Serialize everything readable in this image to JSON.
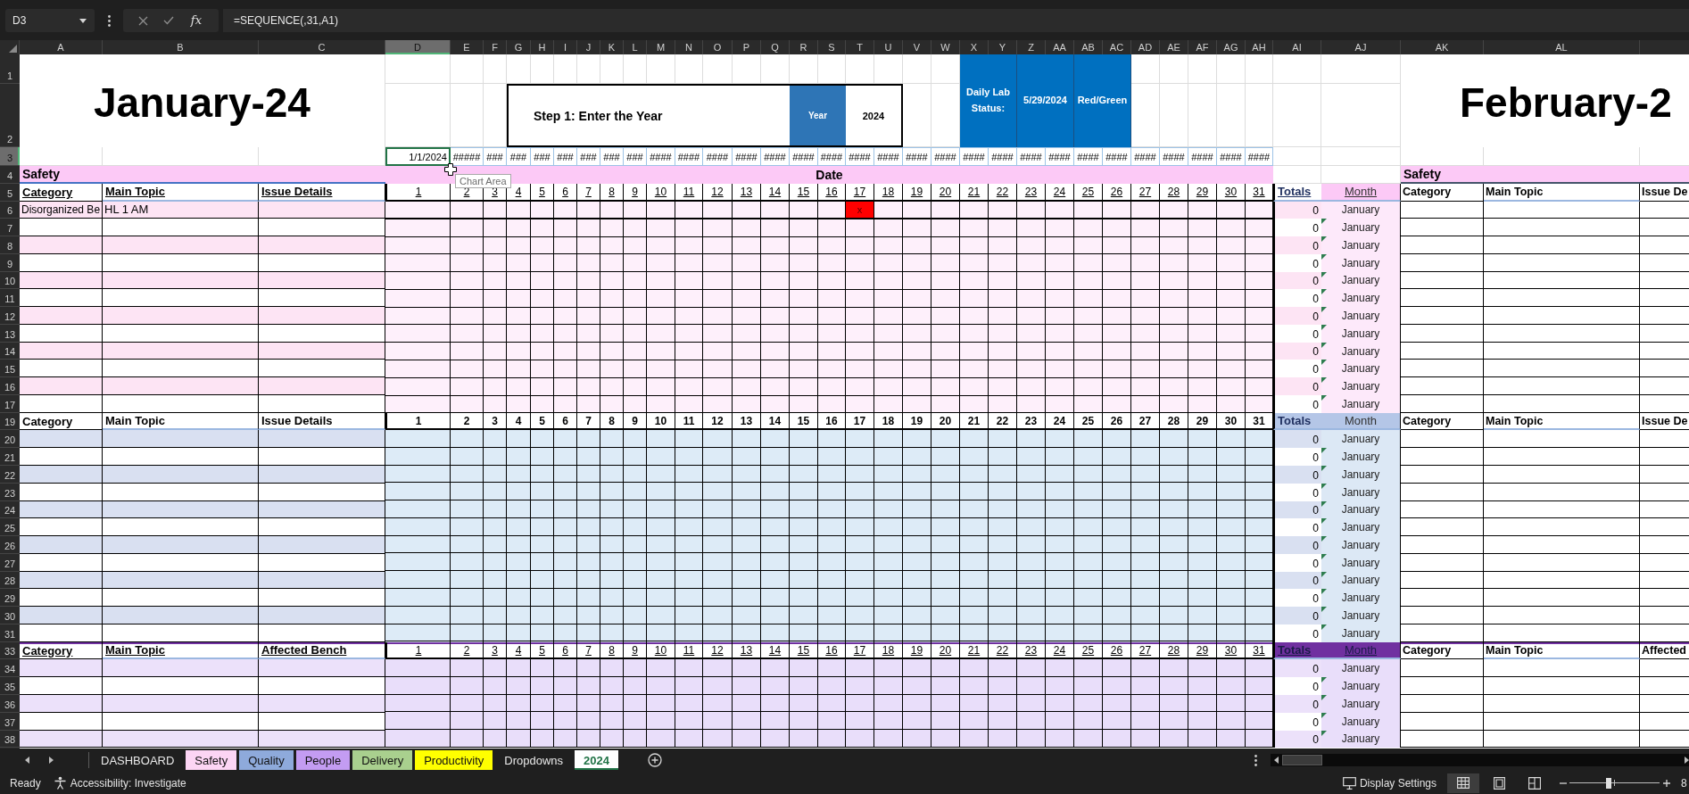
{
  "formula_bar": {
    "name_box": "D3",
    "function_label": "fx",
    "formula": "=SEQUENCE(,31,A1)"
  },
  "column_headers": [
    {
      "label": "A",
      "selected": false
    },
    {
      "label": "B",
      "selected": false
    },
    {
      "label": "C",
      "selected": false
    },
    {
      "label": "D",
      "selected": true
    },
    {
      "label": "E",
      "selected": false
    },
    {
      "label": "F",
      "selected": false
    },
    {
      "label": "G",
      "selected": false
    },
    {
      "label": "H",
      "selected": false
    },
    {
      "label": "I",
      "selected": false
    },
    {
      "label": "J",
      "selected": false
    },
    {
      "label": "K",
      "selected": false
    },
    {
      "label": "L",
      "selected": false
    },
    {
      "label": "M",
      "selected": false
    },
    {
      "label": "N",
      "selected": false
    },
    {
      "label": "O",
      "selected": false
    },
    {
      "label": "P",
      "selected": false
    },
    {
      "label": "Q",
      "selected": false
    },
    {
      "label": "R",
      "selected": false
    },
    {
      "label": "S",
      "selected": false
    },
    {
      "label": "T",
      "selected": false
    },
    {
      "label": "U",
      "selected": false
    },
    {
      "label": "V",
      "selected": false
    },
    {
      "label": "W",
      "selected": false
    },
    {
      "label": "X",
      "selected": false
    },
    {
      "label": "Y",
      "selected": false
    },
    {
      "label": "Z",
      "selected": false
    },
    {
      "label": "AA",
      "selected": false
    },
    {
      "label": "AB",
      "selected": false
    },
    {
      "label": "AC",
      "selected": false
    },
    {
      "label": "AD",
      "selected": false
    },
    {
      "label": "AE",
      "selected": false
    },
    {
      "label": "AF",
      "selected": false
    },
    {
      "label": "AG",
      "selected": false
    },
    {
      "label": "AH",
      "selected": false
    },
    {
      "label": "AI",
      "selected": false
    },
    {
      "label": "AJ",
      "selected": false
    },
    {
      "label": "AK",
      "selected": false
    },
    {
      "label": "AL",
      "selected": false
    }
  ],
  "row_headers": [
    {
      "label": "1",
      "selected": false
    },
    {
      "label": "2",
      "selected": false
    },
    {
      "label": "3",
      "selected": true
    },
    {
      "label": "4",
      "selected": false
    },
    {
      "label": "5",
      "selected": false
    },
    {
      "label": "6",
      "selected": false
    },
    {
      "label": "7",
      "selected": false
    },
    {
      "label": "8",
      "selected": false
    },
    {
      "label": "9",
      "selected": false
    },
    {
      "label": "10",
      "selected": false
    },
    {
      "label": "11",
      "selected": false
    },
    {
      "label": "12",
      "selected": false
    },
    {
      "label": "13",
      "selected": false
    },
    {
      "label": "14",
      "selected": false
    },
    {
      "label": "15",
      "selected": false
    },
    {
      "label": "16",
      "selected": false
    },
    {
      "label": "17",
      "selected": false
    },
    {
      "label": "19",
      "selected": false
    },
    {
      "label": "20",
      "selected": false
    },
    {
      "label": "21",
      "selected": false
    },
    {
      "label": "22",
      "selected": false
    },
    {
      "label": "23",
      "selected": false
    },
    {
      "label": "24",
      "selected": false
    },
    {
      "label": "25",
      "selected": false
    },
    {
      "label": "26",
      "selected": false
    },
    {
      "label": "27",
      "selected": false
    },
    {
      "label": "28",
      "selected": false
    },
    {
      "label": "29",
      "selected": false
    },
    {
      "label": "30",
      "selected": false
    },
    {
      "label": "31",
      "selected": false
    },
    {
      "label": "33",
      "selected": false
    },
    {
      "label": "34",
      "selected": false
    },
    {
      "label": "35",
      "selected": false
    },
    {
      "label": "36",
      "selected": false
    },
    {
      "label": "37",
      "selected": false
    },
    {
      "label": "38",
      "selected": false
    }
  ],
  "header_block": {
    "title": "January-24",
    "step_prompt": "Step 1: Enter the Year",
    "year_label": "Year",
    "year_value": "2024",
    "status_label": "Daily Lab Status:",
    "status_date": "5/29/2024",
    "status_mode": "Red/Green",
    "next_title": "February-2"
  },
  "date_row": [
    {
      "text": "1/1/2024",
      "selected": true
    },
    {
      "text": "#####",
      "selected": false
    },
    {
      "text": "###",
      "selected": false
    },
    {
      "text": "###",
      "selected": false
    },
    {
      "text": "###",
      "selected": false
    },
    {
      "text": "###",
      "selected": false
    },
    {
      "text": "###",
      "selected": false
    },
    {
      "text": "###",
      "selected": false
    },
    {
      "text": "###",
      "selected": false
    },
    {
      "text": "####",
      "selected": false
    },
    {
      "text": "####",
      "selected": false
    },
    {
      "text": "####",
      "selected": false
    },
    {
      "text": "####",
      "selected": false
    },
    {
      "text": "####",
      "selected": false
    },
    {
      "text": "####",
      "selected": false
    },
    {
      "text": "####",
      "selected": false
    },
    {
      "text": "####",
      "selected": false
    },
    {
      "text": "####",
      "selected": false
    },
    {
      "text": "####",
      "selected": false
    },
    {
      "text": "####",
      "selected": false
    },
    {
      "text": "####",
      "selected": false
    },
    {
      "text": "####",
      "selected": false
    },
    {
      "text": "####",
      "selected": false
    },
    {
      "text": "####",
      "selected": false
    },
    {
      "text": "####",
      "selected": false
    },
    {
      "text": "####",
      "selected": false
    },
    {
      "text": "####",
      "selected": false
    },
    {
      "text": "####",
      "selected": false
    },
    {
      "text": "####",
      "selected": false
    },
    {
      "text": "####",
      "selected": false
    },
    {
      "text": "####",
      "selected": false
    }
  ],
  "tooltip": {
    "text": "Chart Area"
  },
  "sections": [
    {
      "kind": "safety",
      "title": "Safety",
      "date_label": "Date",
      "underlined": true,
      "headers": {
        "category": "Category",
        "main_topic": "Main Topic",
        "details": "Issue Details",
        "totals": "Totals",
        "month": "Month"
      },
      "days": [
        "1",
        "2",
        "3",
        "4",
        "5",
        "6",
        "7",
        "8",
        "9",
        "10",
        "11",
        "12",
        "13",
        "14",
        "15",
        "16",
        "17",
        "18",
        "19",
        "20",
        "21",
        "22",
        "23",
        "24",
        "25",
        "26",
        "27",
        "28",
        "29",
        "30",
        "31"
      ],
      "next_month": {
        "title": "Safety",
        "category": "Category",
        "main_topic": "Main Topic",
        "details": "Issue De"
      },
      "rows": [
        {
          "category": "Disorganized Be",
          "main_topic": "HL 1 AM",
          "days": [
            {
              "marked": false
            },
            {
              "marked": false
            },
            {
              "marked": false
            },
            {
              "marked": false
            },
            {
              "marked": false
            },
            {
              "marked": false
            },
            {
              "marked": false
            },
            {
              "marked": false
            },
            {
              "marked": false
            },
            {
              "marked": false
            },
            {
              "marked": false
            },
            {
              "marked": false
            },
            {
              "marked": false
            },
            {
              "marked": false
            },
            {
              "marked": false
            },
            {
              "marked": false
            },
            {
              "text": "x",
              "marked": true,
              "color": "#ff0000"
            },
            {
              "marked": false
            },
            {
              "marked": false
            },
            {
              "marked": false
            },
            {
              "marked": false
            },
            {
              "marked": false
            },
            {
              "marked": false
            },
            {
              "marked": false
            },
            {
              "marked": false
            },
            {
              "marked": false
            },
            {
              "marked": false
            },
            {
              "marked": false
            },
            {
              "marked": false
            },
            {
              "marked": false
            },
            {
              "marked": false
            }
          ],
          "total": "0",
          "month": "January",
          "flagged": false
        },
        {
          "total": "0",
          "month": "January",
          "flagged": true
        },
        {
          "total": "0",
          "month": "January",
          "flagged": true
        },
        {
          "total": "0",
          "month": "January",
          "flagged": true
        },
        {
          "total": "0",
          "month": "January",
          "flagged": true
        },
        {
          "total": "0",
          "month": "January",
          "flagged": true
        },
        {
          "total": "0",
          "month": "January",
          "flagged": true
        },
        {
          "total": "0",
          "month": "January",
          "flagged": true
        },
        {
          "total": "0",
          "month": "January",
          "flagged": true
        },
        {
          "total": "0",
          "month": "January",
          "flagged": true
        },
        {
          "total": "0",
          "month": "January",
          "flagged": true
        },
        {
          "total": "0",
          "month": "January",
          "flagged": true
        }
      ]
    },
    {
      "kind": "quality",
      "underlined": false,
      "headers": {
        "category": "Category",
        "main_topic": "Main Topic",
        "details": "Issue Details",
        "totals": "Totals",
        "month": "Month"
      },
      "days": [
        "1",
        "2",
        "3",
        "4",
        "5",
        "6",
        "7",
        "8",
        "9",
        "10",
        "11",
        "12",
        "13",
        "14",
        "15",
        "16",
        "17",
        "18",
        "19",
        "20",
        "21",
        "22",
        "23",
        "24",
        "25",
        "26",
        "27",
        "28",
        "29",
        "30",
        "31"
      ],
      "next_month": {
        "category": "Category",
        "main_topic": "Main Topic",
        "details": "Issue De"
      },
      "rows": [
        {
          "total": "0",
          "month": "January",
          "flagged": false
        },
        {
          "total": "0",
          "month": "January",
          "flagged": true
        },
        {
          "total": "0",
          "month": "January",
          "flagged": true
        },
        {
          "total": "0",
          "month": "January",
          "flagged": true
        },
        {
          "total": "0",
          "month": "January",
          "flagged": true
        },
        {
          "total": "0",
          "month": "January",
          "flagged": true
        },
        {
          "total": "0",
          "month": "January",
          "flagged": true
        },
        {
          "total": "0",
          "month": "January",
          "flagged": true
        },
        {
          "total": "0",
          "month": "January",
          "flagged": true
        },
        {
          "total": "0",
          "month": "January",
          "flagged": true
        },
        {
          "total": "0",
          "month": "January",
          "flagged": true
        },
        {
          "total": "0",
          "month": "January",
          "flagged": true
        }
      ]
    },
    {
      "kind": "people",
      "underlined": true,
      "headers": {
        "category": "Category",
        "main_topic": "Main Topic",
        "details": "Affected Bench",
        "totals": "Totals",
        "month": "Month"
      },
      "days": [
        "1",
        "2",
        "3",
        "4",
        "5",
        "6",
        "7",
        "8",
        "9",
        "10",
        "11",
        "12",
        "13",
        "14",
        "15",
        "16",
        "17",
        "18",
        "19",
        "20",
        "21",
        "22",
        "23",
        "24",
        "25",
        "26",
        "27",
        "28",
        "29",
        "30",
        "31"
      ],
      "next_month": {
        "category": "Category",
        "main_topic": "Main Topic",
        "details": "Affected"
      },
      "rows": [
        {
          "total": "0",
          "month": "January",
          "flagged": false
        },
        {
          "total": "0",
          "month": "January",
          "flagged": true
        },
        {
          "total": "0",
          "month": "January",
          "flagged": true
        },
        {
          "total": "0",
          "month": "January",
          "flagged": true
        },
        {
          "total": "0",
          "month": "January",
          "flagged": true
        }
      ]
    }
  ],
  "sheet_tabs": [
    {
      "label": "DASHBOARD",
      "selected": false
    },
    {
      "label": "Safety",
      "color": "#fcd5f4",
      "selected": false
    },
    {
      "label": "Quality",
      "color": "#8eaadb",
      "selected": false
    },
    {
      "label": "People",
      "color": "#c39cf2",
      "selected": false
    },
    {
      "label": "Delivery",
      "color": "#a9d08e",
      "selected": false
    },
    {
      "label": "Productivity",
      "color": "#ffff00",
      "selected": false
    },
    {
      "label": "Dropdowns",
      "selected": false
    },
    {
      "label": "2024",
      "selected": true
    }
  ],
  "status_bar": {
    "mode": "Ready",
    "accessibility": "Accessibility: Investigate",
    "display_settings": "Display Settings",
    "views": [
      {
        "kind": "normal",
        "selected": true
      },
      {
        "kind": "page_layout",
        "selected": false
      },
      {
        "kind": "page_break",
        "selected": false
      }
    ],
    "zoom": {
      "level": 0.43,
      "label": "8"
    }
  }
}
